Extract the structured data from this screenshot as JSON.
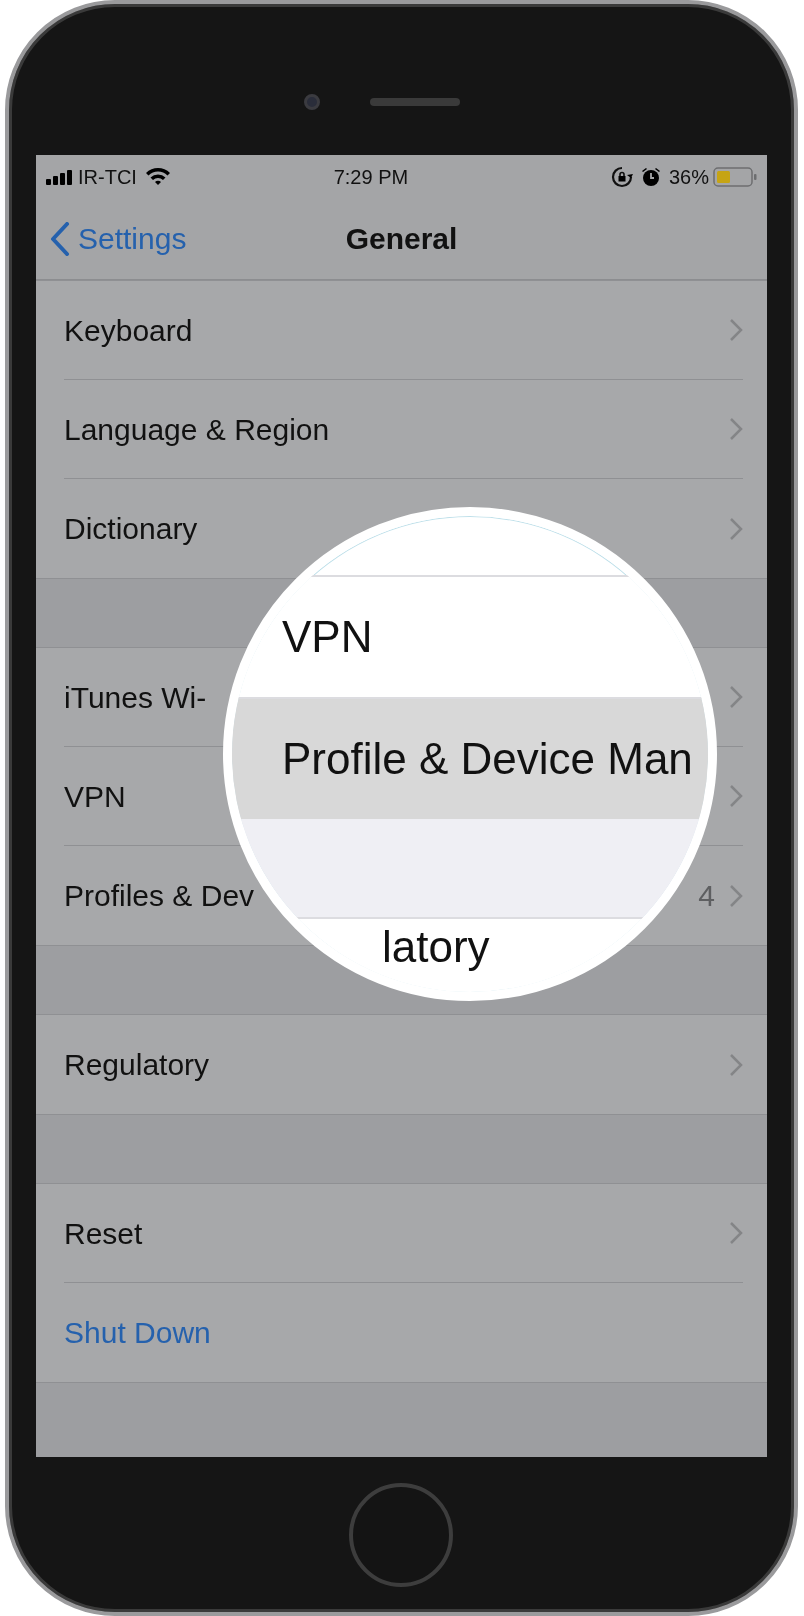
{
  "status_bar": {
    "carrier": "IR-TCI",
    "time": "7:29 PM",
    "battery": "36%"
  },
  "nav": {
    "back": "Settings",
    "title": "General"
  },
  "sections": [
    {
      "rows": [
        {
          "kind": "link",
          "label": "Keyboard"
        },
        {
          "kind": "link",
          "label": "Language & Region"
        },
        {
          "kind": "link",
          "label": "Dictionary"
        }
      ]
    },
    {
      "rows": [
        {
          "kind": "link",
          "label": "iTunes Wi-"
        },
        {
          "kind": "link",
          "label": "VPN"
        },
        {
          "kind": "link",
          "label": "Profiles & Dev",
          "value": "4"
        }
      ]
    },
    {
      "rows": [
        {
          "kind": "link",
          "label": "Regulatory"
        }
      ]
    },
    {
      "rows": [
        {
          "kind": "link",
          "label": "Reset"
        },
        {
          "kind": "action",
          "label": "Shut Down"
        }
      ]
    }
  ],
  "magnifier": {
    "items": [
      {
        "kind": "row",
        "label": "VPN",
        "selected": false
      },
      {
        "kind": "row",
        "label": "Profile & Device Man",
        "selected": true
      },
      {
        "kind": "gap"
      },
      {
        "kind": "row",
        "label": "latory",
        "selected": false
      }
    ]
  }
}
